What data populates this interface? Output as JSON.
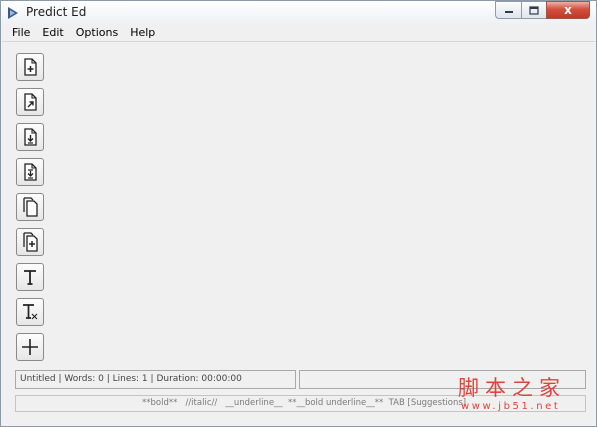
{
  "window": {
    "title": "Predict Ed",
    "close_label": "x"
  },
  "menu": [
    {
      "label": "File"
    },
    {
      "label": "Edit"
    },
    {
      "label": "Options"
    },
    {
      "label": "Help"
    }
  ],
  "toolbar": {
    "buttons": [
      {
        "icon": "new-document-icon"
      },
      {
        "icon": "open-document-icon"
      },
      {
        "icon": "save-document-icon"
      },
      {
        "icon": "save-as-document-icon"
      },
      {
        "icon": "copy-document-icon"
      },
      {
        "icon": "duplicate-document-icon"
      },
      {
        "icon": "text-format-icon"
      },
      {
        "icon": "clear-format-icon"
      },
      {
        "icon": "plus-icon"
      }
    ]
  },
  "status": {
    "document_name": "Untitled",
    "words": "Words: 0",
    "lines": "Lines: 1",
    "duration": "Duration: 00:00:00",
    "separator": " | "
  },
  "hint": "**bold**   //italic//   __underline__  **__bold underline__**  TAB [Suggestions]",
  "watermark": {
    "cn": "脚本之家",
    "url": "www.jb51.net",
    "color": "#e0433a"
  },
  "colors": {
    "background": "#f0f0f0",
    "close_button": "#c23824"
  }
}
